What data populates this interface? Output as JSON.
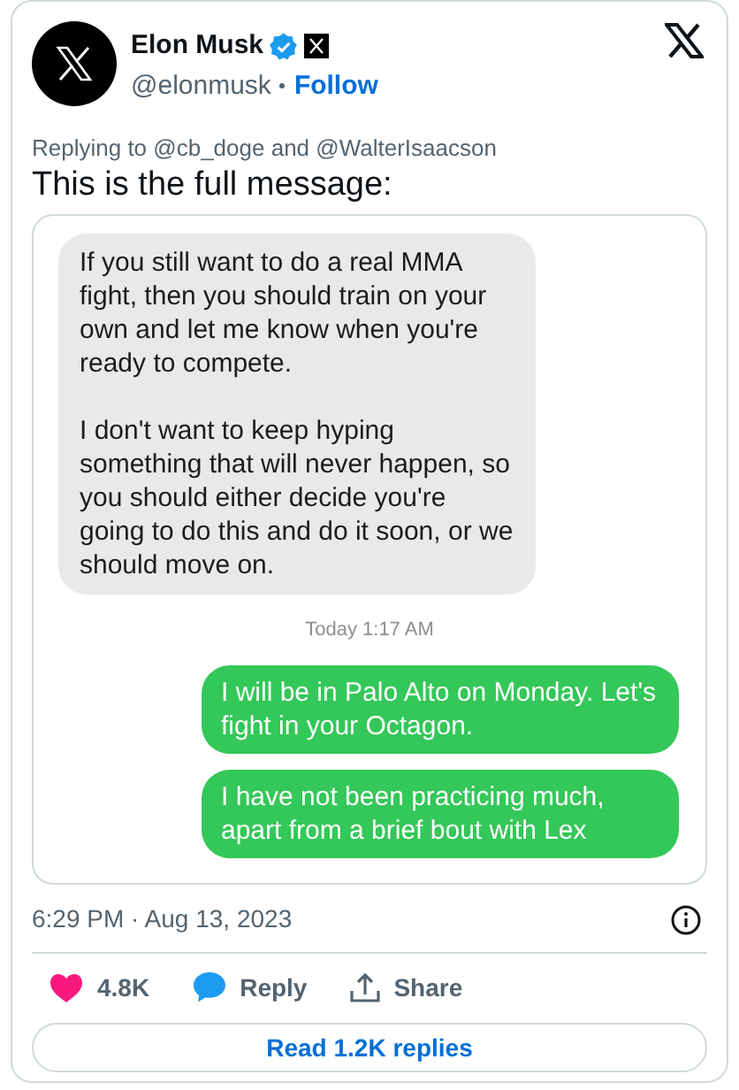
{
  "author": {
    "name": "Elon Musk",
    "handle": "@elonmusk",
    "follow": "Follow"
  },
  "replying_to": {
    "prefix": "Replying to ",
    "users": [
      "@cb_doge",
      "@WalterIsaacson"
    ],
    "joiner": " and "
  },
  "text": "This is the full message:",
  "messages": [
    {
      "kind": "received",
      "paragraphs": [
        "If you still want to do a real MMA fight, then you should train on your own and let me know when you're ready to compete.",
        "I don't want to keep hyping something that will never happen, so you should either decide you're going to do this and do it soon, or we should move on."
      ]
    },
    {
      "kind": "time",
      "text": "Today 1:17 AM"
    },
    {
      "kind": "sent",
      "paragraphs": [
        "I will be in Palo Alto on Monday. Let's fight in your Octagon."
      ]
    },
    {
      "kind": "sent",
      "paragraphs": [
        "I have not been practicing much, apart from a brief bout with Lex"
      ]
    }
  ],
  "timestamp": "6:29 PM · Aug 13, 2023",
  "actions": [
    {
      "kind": "like",
      "label": "4.8K"
    },
    {
      "kind": "reply",
      "label": "Reply"
    },
    {
      "kind": "share",
      "label": "Share"
    }
  ],
  "read_replies": "Read 1.2K replies"
}
